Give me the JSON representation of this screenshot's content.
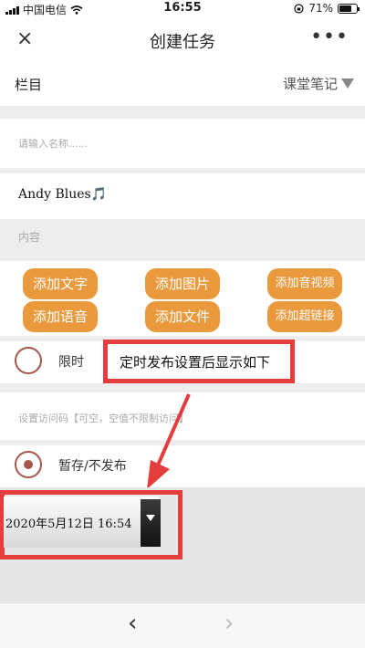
{
  "status": {
    "carrier": "中国电信",
    "time": "16:55",
    "battery": "71%",
    "battery_level": 0.71
  },
  "nav": {
    "close_icon": "×",
    "title": "创建任务",
    "more_icon": "•••"
  },
  "category": {
    "label": "栏目",
    "value": "课堂笔记"
  },
  "name": {
    "placeholder": "请输入名称......"
  },
  "author": {
    "text": "Andy Blues🎵"
  },
  "content": {
    "placeholder": "内容"
  },
  "buttons": [
    "添加文字",
    "添加图片",
    "添加音视频",
    "添加语音",
    "添加文件",
    "添加超链接"
  ],
  "timed": {
    "label": "限时"
  },
  "annotation": {
    "text": "定时发布设置后显示如下"
  },
  "access_code": {
    "placeholder": "设置访问码【可空，空值不限制访问】"
  },
  "draft": {
    "label": "暂存/不发布"
  },
  "schedule": {
    "datetime": "2020年5月12日 16:54"
  },
  "colors": {
    "accent": "#ea9a3d",
    "radio": "#a4574a",
    "annotation": "#e53d3d"
  }
}
